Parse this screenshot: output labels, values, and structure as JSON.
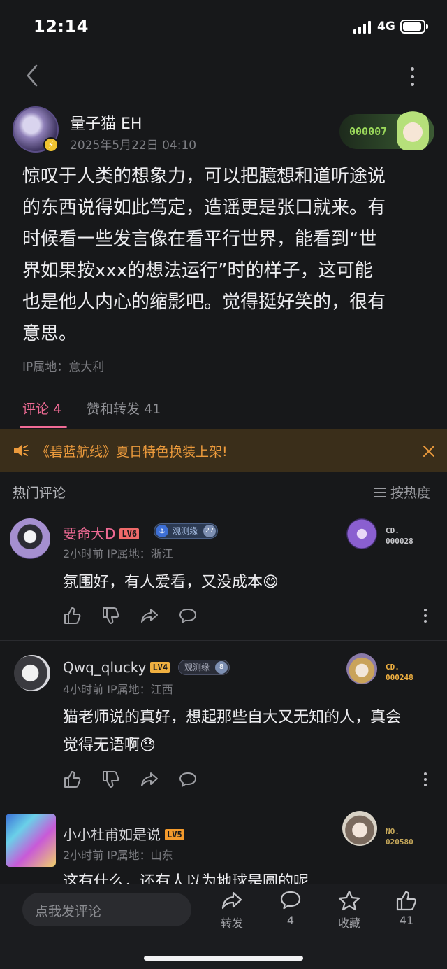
{
  "status": {
    "time": "12:14",
    "network": "4G"
  },
  "post": {
    "author": "量子猫 EH",
    "time": "2025年5月22日 04:10",
    "fan_number": "000007",
    "body_lines": [
      "惊叹于人类的想象力，可以把臆想和道听途说",
      "的东西说得如此笃定，造谣更是张口就来。有",
      "时候看一些发言像在看平行世界，能看到“世",
      "界如果按xxx的想法运行”时的样子，这可能",
      "也是他人内心的缩影吧。觉得挺好笑的，很有",
      "意思。"
    ],
    "ip": "IP属地：意大利"
  },
  "tabs": {
    "comments": "评论 4",
    "likes": "赞和转发 41"
  },
  "notice": {
    "text": "《碧蓝航线》夏日特色换装上架!"
  },
  "hot": {
    "title": "热门评论",
    "sort": "按热度"
  },
  "comments": [
    {
      "name": "要命大D",
      "level": "LV6",
      "tag": "观测缘",
      "tag_count": "27",
      "meta": "2小时前  IP属地：浙江",
      "text": "氛围好，有人爱看，又没成本",
      "emoji": "😋",
      "fan_code_top": "CD.",
      "fan_code_num": "000028"
    },
    {
      "name": "Qwq_qlucky",
      "level": "LV4",
      "tag": "观测缘",
      "tag_count": "8",
      "meta": "4小时前  IP属地：江西",
      "text_lines": [
        "猫老师说的真好，想起那些自大又无知的人，真会",
        "觉得无语啊"
      ],
      "emoji": "😓",
      "fan_code_top": "CD.",
      "fan_code_num": "000248"
    },
    {
      "name": "小小杜甫如是说",
      "level": "LV5",
      "meta": "2小时前  IP属地：山东",
      "text": "这有什么，还有人以为地球是圆的呢",
      "fan_code_top": "NO.",
      "fan_code_num": "020580"
    }
  ],
  "bottom": {
    "input_placeholder": "点我发评论",
    "share": "转发",
    "comment_count": "4",
    "favorite": "收藏",
    "like_count": "41"
  },
  "colors": {
    "accent": "#f06b95",
    "notice_text": "#eb9a3c",
    "bg": "#17181a"
  },
  "icons": [
    "back-icon",
    "more-icon",
    "speaker-icon",
    "close-icon",
    "sort-icon",
    "thumb-up-icon",
    "thumb-down-icon",
    "share-icon",
    "comment-icon",
    "star-icon"
  ]
}
